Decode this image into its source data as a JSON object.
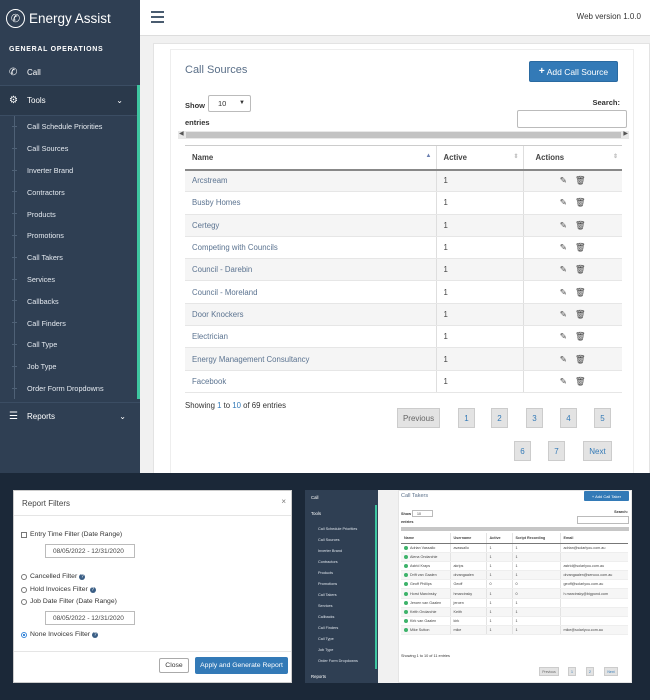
{
  "app": {
    "title": "Energy Assist",
    "version": "Web version 1.0.0",
    "section_title": "GENERAL OPERATIONS",
    "nav_call": "Call",
    "nav_tools": "Tools",
    "nav_reports": "Reports",
    "tools_items": [
      "Call Schedule Priorities",
      "Call Sources",
      "Inverter Brand",
      "Contractors",
      "Products",
      "Promotions",
      "Call Takers",
      "Services",
      "Callbacks",
      "Call Finders",
      "Call Type",
      "Job Type",
      "Order Form Dropdowns"
    ],
    "accent_color": "#3ec6a0",
    "sidebar_color": "#2f3f53"
  },
  "page": {
    "title": "Call Sources",
    "add_button": "Add Call Source",
    "show_label": "Show",
    "entries_label": "entries",
    "page_length": "10",
    "search_label": "Search:",
    "columns": [
      "Name",
      "Active",
      "Actions"
    ],
    "rows": [
      {
        "name": "Arcstream",
        "active": "1"
      },
      {
        "name": "Busby Homes",
        "active": "1"
      },
      {
        "name": "Certegy",
        "active": "1"
      },
      {
        "name": "Competing with Councils",
        "active": "1"
      },
      {
        "name": "Council - Darebin",
        "active": "1"
      },
      {
        "name": "Council - Moreland",
        "active": "1"
      },
      {
        "name": "Door Knockers",
        "active": "1"
      },
      {
        "name": "Electrician",
        "active": "1"
      },
      {
        "name": "Energy Management Consultancy",
        "active": "1"
      },
      {
        "name": "Facebook",
        "active": "1"
      }
    ],
    "info": {
      "prefix": "Showing ",
      "start": "1",
      "mid": " to ",
      "end": "10",
      "suffix": " of 69 entries"
    },
    "pagination": [
      "Previous",
      "1",
      "2",
      "3",
      "4",
      "5",
      "6",
      "7",
      "Next"
    ]
  },
  "modal": {
    "title": "Report Filters",
    "close_x": "×",
    "entry_time_filter": "Entry Time Filter (Date Range)",
    "entry_date_range": "08/05/2022 - 12/31/2020",
    "cancelled_filter": "Cancelled Filter",
    "hold_invoices_filter": "Hold Invoices Filter",
    "job_date_filter": "Job Date Filter (Date Range)",
    "job_date_range": "08/05/2022 - 12/31/2020",
    "none_invoices_filter": "None Invoices Filter",
    "close_button": "Close",
    "apply_button": "Apply and Generate Report"
  },
  "mini": {
    "nav": [
      "Call",
      "Tools",
      "Call Schedule Priorities",
      "Call Sources",
      "Inverter Brand",
      "Contractors",
      "Products",
      "Promotions",
      "Call Takers",
      "Services",
      "Callbacks",
      "Call Finders",
      "Call Type",
      "Job Type",
      "Order Form Dropdowns",
      "Reports"
    ],
    "title": "Call Takers",
    "add_button": "+ Add Call Taker",
    "show": "Show",
    "length": "10",
    "entries": "entries",
    "search": "Search:",
    "columns": [
      "Name",
      "Username",
      "Active",
      "Script Recording",
      "Email"
    ],
    "rows": [
      [
        "Adrian Vassallo",
        "avassallo",
        "1",
        "1",
        "adrian@solarlyou.com.au"
      ],
      [
        "Alena Ondarchie",
        "",
        "1",
        "1",
        ""
      ],
      [
        "Astrid Kraps",
        "akrips",
        "1",
        "1",
        "astrid@solarlyou.com.au"
      ],
      [
        "Drift van Gaalen",
        "drvangaalen",
        "1",
        "1",
        "drvangaalen@sencco.com.au"
      ],
      [
        "Geoff Phillips",
        "Geoff",
        "0",
        "0",
        "geoff@solarlyou.com.au"
      ],
      [
        "Horst Marcinsky",
        "hmarcinsky",
        "1",
        "0",
        "h.marcinsky@bigpond.com"
      ],
      [
        "Jeroen van Gaalen",
        "jeroen",
        "1",
        "1",
        ""
      ],
      [
        "Keith Ondarchie",
        "Keith",
        "1",
        "1",
        ""
      ],
      [
        "Kirk van Gaalen",
        "kirk",
        "1",
        "1",
        ""
      ],
      [
        "Mike Sutton",
        "mike",
        "1",
        "1",
        "mike@solarlyou.com.au"
      ]
    ],
    "info": "Showing 1 to 10 of 11 entries",
    "pagination": [
      "Previous",
      "1",
      "2",
      "Next"
    ]
  }
}
